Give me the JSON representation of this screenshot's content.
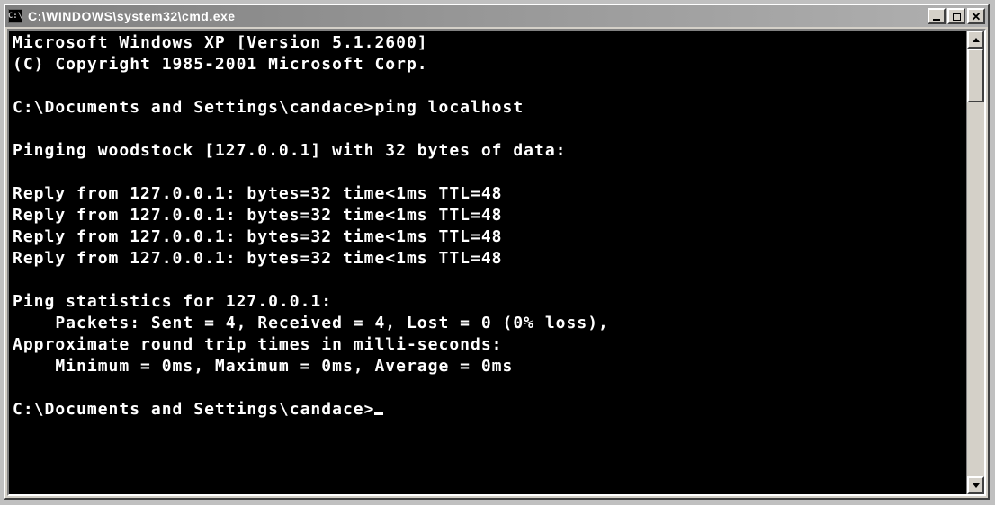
{
  "window": {
    "icon_text": "C:\\",
    "title": "C:\\WINDOWS\\system32\\cmd.exe"
  },
  "console": {
    "lines": [
      "Microsoft Windows XP [Version 5.1.2600]",
      "(C) Copyright 1985-2001 Microsoft Corp.",
      "",
      "C:\\Documents and Settings\\candace>ping localhost",
      "",
      "Pinging woodstock [127.0.0.1] with 32 bytes of data:",
      "",
      "Reply from 127.0.0.1: bytes=32 time<1ms TTL=48",
      "Reply from 127.0.0.1: bytes=32 time<1ms TTL=48",
      "Reply from 127.0.0.1: bytes=32 time<1ms TTL=48",
      "Reply from 127.0.0.1: bytes=32 time<1ms TTL=48",
      "",
      "Ping statistics for 127.0.0.1:",
      "    Packets: Sent = 4, Received = 4, Lost = 0 (0% loss),",
      "Approximate round trip times in milli-seconds:",
      "    Minimum = 0ms, Maximum = 0ms, Average = 0ms",
      "",
      "C:\\Documents and Settings\\candace>"
    ]
  }
}
